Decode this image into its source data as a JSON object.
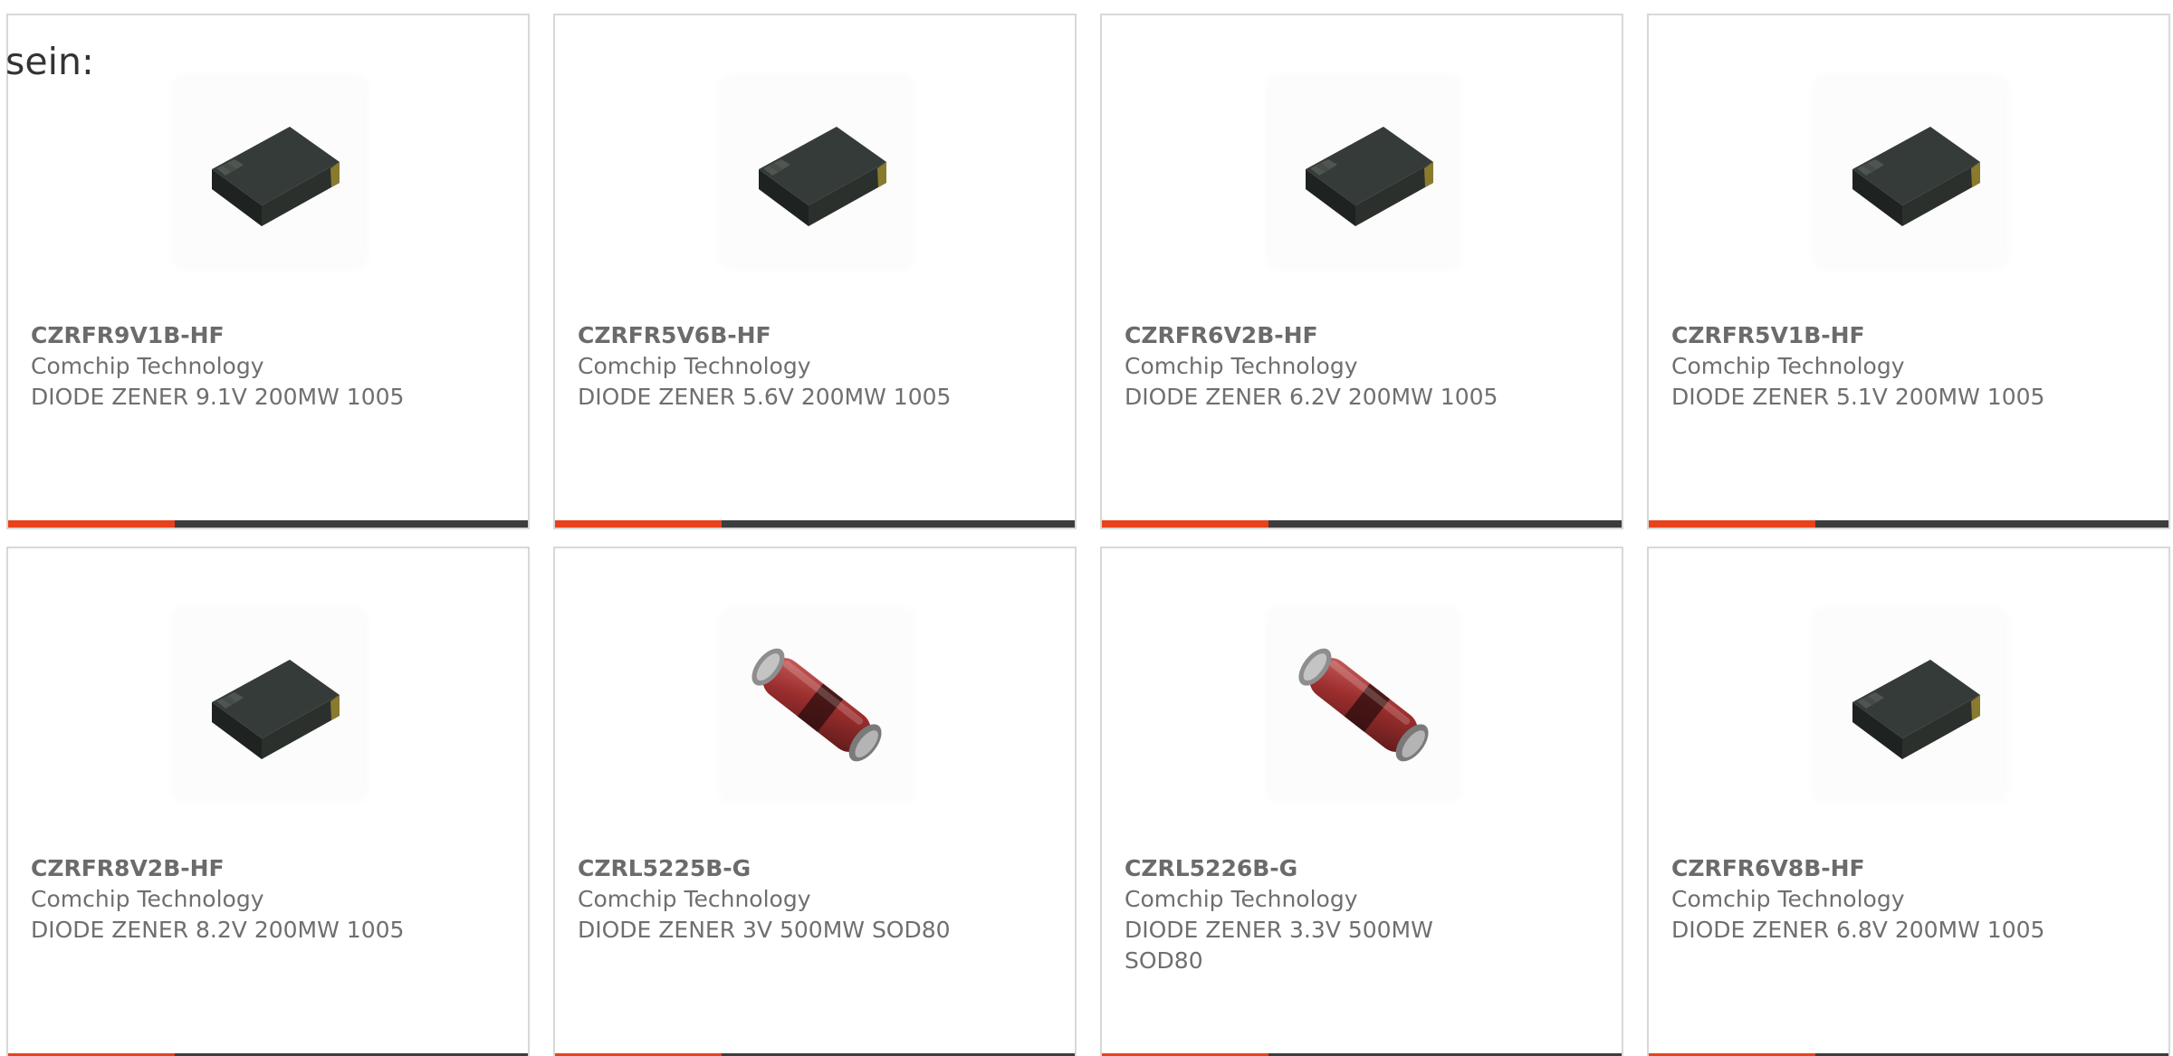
{
  "intro_text": "sein:",
  "colors": {
    "accent": "#e8421c",
    "bar": "#3d3d3d",
    "border": "#d8d8d8",
    "text": "#6f6f6f"
  },
  "products": [
    {
      "part_number": "CZRFR9V1B-HF",
      "manufacturer": "Comchip Technology",
      "description": "DIODE ZENER 9.1V 200MW 1005",
      "image_icon": "smd-chip-diode-image"
    },
    {
      "part_number": "CZRFR5V6B-HF",
      "manufacturer": "Comchip Technology",
      "description": "DIODE ZENER 5.6V 200MW 1005",
      "image_icon": "smd-chip-diode-image"
    },
    {
      "part_number": "CZRFR6V2B-HF",
      "manufacturer": "Comchip Technology",
      "description": "DIODE ZENER 6.2V 200MW 1005",
      "image_icon": "smd-chip-diode-image"
    },
    {
      "part_number": "CZRFR5V1B-HF",
      "manufacturer": "Comchip Technology",
      "description": "DIODE ZENER 5.1V 200MW 1005",
      "image_icon": "smd-chip-diode-image"
    },
    {
      "part_number": "CZRFR8V2B-HF",
      "manufacturer": "Comchip Technology",
      "description": "DIODE ZENER 8.2V 200MW 1005",
      "image_icon": "smd-chip-diode-image"
    },
    {
      "part_number": "CZRL5225B-G",
      "manufacturer": "Comchip Technology",
      "description": "DIODE ZENER 3V 500MW SOD80",
      "image_icon": "glass-melf-diode-image"
    },
    {
      "part_number": "CZRL5226B-G",
      "manufacturer": "Comchip Technology",
      "description": "DIODE ZENER 3.3V 500MW SOD80",
      "image_icon": "glass-melf-diode-image"
    },
    {
      "part_number": "CZRFR6V8B-HF",
      "manufacturer": "Comchip Technology",
      "description": "DIODE ZENER 6.8V 200MW 1005",
      "image_icon": "smd-chip-diode-image"
    }
  ]
}
